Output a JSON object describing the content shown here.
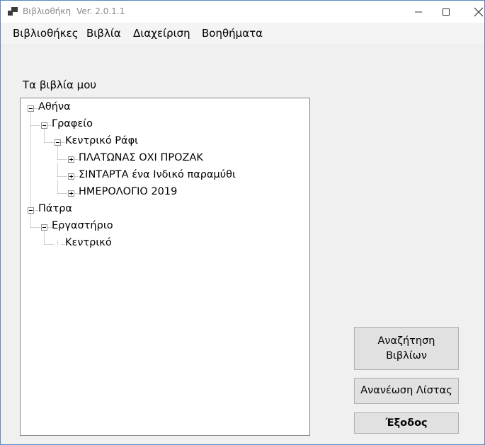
{
  "window": {
    "title": "Βιβλιοθήκη",
    "version": "Ver. 2.0.1.1"
  },
  "menu": [
    "Βιβλιοθήκες",
    "Βιβλία",
    "Διαχείριση",
    "Βοηθήματα"
  ],
  "tree_label": "Τα βιβλία μου",
  "tree": [
    {
      "label": "Αθήνα",
      "level": 0,
      "expander": "minus"
    },
    {
      "label": "Γραφείο",
      "level": 1,
      "expander": "minus"
    },
    {
      "label": "Κεντρικό Ράφι",
      "level": 2,
      "expander": "minus"
    },
    {
      "label": "ΠΛΑΤΩΝΑΣ ΟΧΙ ΠΡΟΖΑΚ",
      "level": 3,
      "expander": "plus"
    },
    {
      "label": "ΣΙΝΤΑΡΤΑ ένα Ινδικό παραμύθι",
      "level": 3,
      "expander": "plus"
    },
    {
      "label": "ΗΜΕΡΟΛΟΓΙΟ 2019",
      "level": 3,
      "expander": "plus"
    },
    {
      "label": "Πάτρα",
      "level": 0,
      "expander": "minus"
    },
    {
      "label": "Εργαστήριο",
      "level": 1,
      "expander": "minus"
    },
    {
      "label": "Κεντρικό",
      "level": 2,
      "expander": "none"
    }
  ],
  "buttons": {
    "search": "Αναζήτηση\nΒιβλίων",
    "refresh": "Ανανέωση Λίστας",
    "exit": "Έξοδος"
  }
}
